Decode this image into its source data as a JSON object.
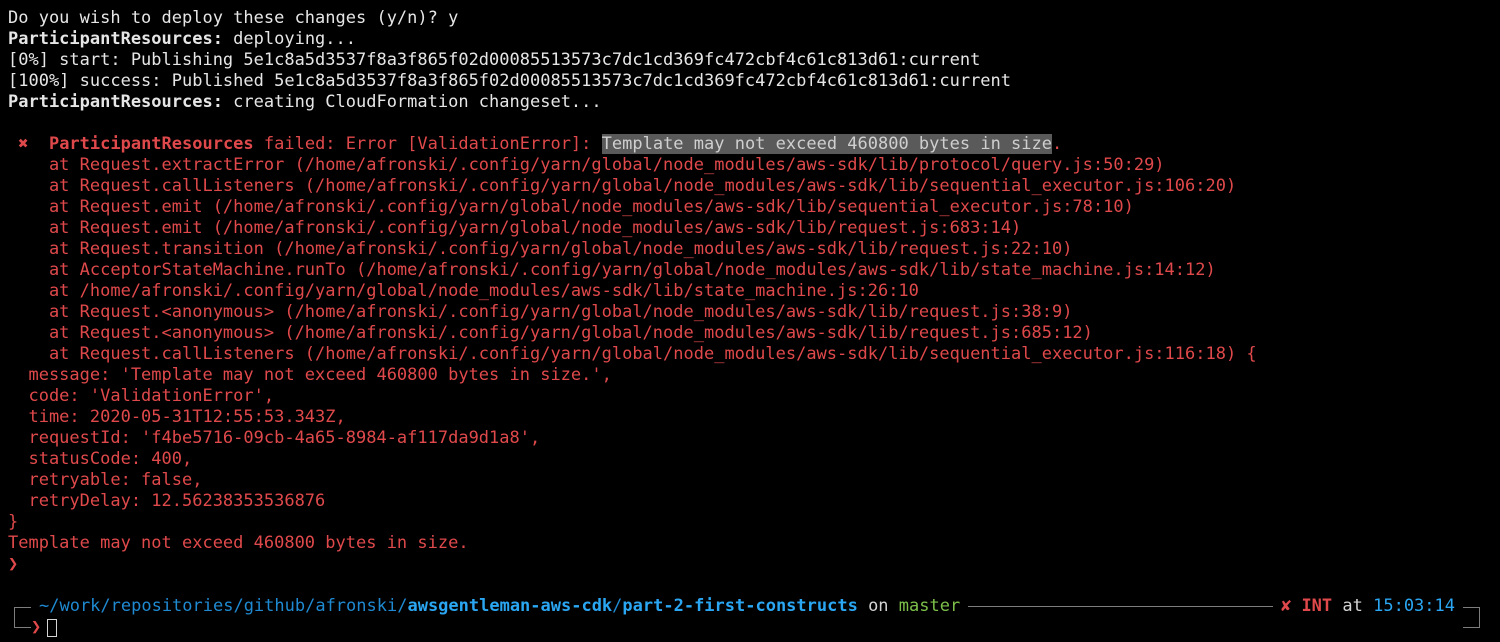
{
  "terminal": {
    "confirm": "Do you wish to deploy these changes (y/n)? y",
    "deploy_stack": "ParticipantResources:",
    "deploy_text": " deploying...",
    "publish_start": "[0%] start: Publishing 5e1c8a5d3537f8a3f865f02d00085513573c7dc1cd369fc472cbf4c61c813d61:current",
    "publish_success": "[100%] success: Published 5e1c8a5d3537f8a3f865f02d00085513573c7dc1cd369fc472cbf4c61c813d61:current",
    "changeset_stack": "ParticipantResources:",
    "changeset_text": " creating CloudFormation changeset...",
    "error": {
      "mark": " ✖ ",
      "stack": " ParticipantResources",
      "prefix": " failed: Error [ValidationError]: ",
      "highlight": "Template may not exceed 460800 bytes in size",
      "suffix": "."
    },
    "stack_trace": [
      "    at Request.extractError (/home/afronski/.config/yarn/global/node_modules/aws-sdk/lib/protocol/query.js:50:29)",
      "    at Request.callListeners (/home/afronski/.config/yarn/global/node_modules/aws-sdk/lib/sequential_executor.js:106:20)",
      "    at Request.emit (/home/afronski/.config/yarn/global/node_modules/aws-sdk/lib/sequential_executor.js:78:10)",
      "    at Request.emit (/home/afronski/.config/yarn/global/node_modules/aws-sdk/lib/request.js:683:14)",
      "    at Request.transition (/home/afronski/.config/yarn/global/node_modules/aws-sdk/lib/request.js:22:10)",
      "    at AcceptorStateMachine.runTo (/home/afronski/.config/yarn/global/node_modules/aws-sdk/lib/state_machine.js:14:12)",
      "    at /home/afronski/.config/yarn/global/node_modules/aws-sdk/lib/state_machine.js:26:10",
      "    at Request.<anonymous> (/home/afronski/.config/yarn/global/node_modules/aws-sdk/lib/request.js:38:9)",
      "    at Request.<anonymous> (/home/afronski/.config/yarn/global/node_modules/aws-sdk/lib/request.js:685:12)",
      "    at Request.callListeners (/home/afronski/.config/yarn/global/node_modules/aws-sdk/lib/sequential_executor.js:116:18) {"
    ],
    "error_object": [
      "  message: 'Template may not exceed 460800 bytes in size.',",
      "  code: 'ValidationError',",
      "  time: 2020-05-31T12:55:53.343Z,",
      "  requestId: 'f4be5716-09cb-4a65-8984-af117da9d1a8',",
      "  statusCode: 400,",
      "  retryable: false,",
      "  retryDelay: 12.56238353536876",
      "}"
    ],
    "final_error": "Template may not exceed 460800 bytes in size.",
    "prompt_char": "❯"
  },
  "prompt": {
    "path_dim": "~/work/repositories/github/afronski/",
    "path_bold_1": "awsgentleman-aws-cdk",
    "path_sep": "/",
    "path_bold_2": "part-2-first-constructs",
    "on": " on ",
    "branch": "master",
    "status_x": "✘ ",
    "status_int": "INT",
    "at": " at ",
    "time": "15:03:14",
    "input_char": "❯",
    "input_value": ""
  },
  "colors": {
    "background": "#000000",
    "foreground": "#d4d4d4",
    "error_red": "#e0494b",
    "path_blue": "#2aa6f2",
    "branch_green": "#7cc04a",
    "highlight_gray": "#5a5a5a"
  }
}
